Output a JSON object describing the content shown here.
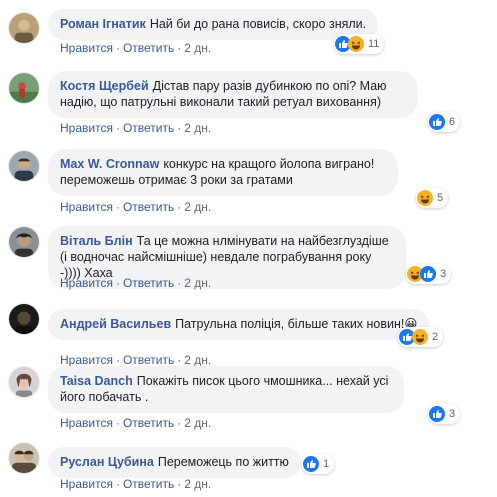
{
  "ui": {
    "like_label": "Нравится",
    "reply_label": "Ответить",
    "separator": "·"
  },
  "comments": [
    {
      "author": "Роман Ігнатик",
      "text": "Най би до рана повисів, скоро зняли.",
      "time": "2 дн.",
      "reactions": [
        "like",
        "haha"
      ],
      "reaction_count": "11"
    },
    {
      "author": "Костя Щербей",
      "text": "Дістав пару разів дубинкою по опі? Маю надію, що патрульні виконали такий ретуал виховання)",
      "time": "2 дн.",
      "reactions": [
        "like"
      ],
      "reaction_count": "6"
    },
    {
      "author": "Max W. Cronnaw",
      "text": "конкурс на кращого йолопа виграно! переможешь отримає 3 роки за гратами",
      "time": "2 дн.",
      "reactions": [
        "haha"
      ],
      "reaction_count": "5"
    },
    {
      "author": "Віталь Блін",
      "text": "Та це можна нлмінувати на найбезглуздіше (і водночас найсмішніше) невдале пограбування року -)))) Хаха",
      "time": "2 дн.",
      "reactions": [
        "haha",
        "like"
      ],
      "reaction_count": "3"
    },
    {
      "author": "Андрей Васильев",
      "text": "Патрульна поліція, більше таких новин!",
      "emoji": "😀",
      "time": "2 дн.",
      "reactions": [
        "like",
        "haha"
      ],
      "reaction_count": "2"
    },
    {
      "author": "Taisa Danch",
      "text": "Покажіть писок цього чмошника... нехай усі його побачать .",
      "time": "2 дн.",
      "reactions": [
        "like"
      ],
      "reaction_count": "3"
    },
    {
      "author": "Руслан Цубина",
      "text": "Переможець по життю",
      "time": "2 дн.",
      "reactions": [
        "like"
      ],
      "reaction_count": "1"
    }
  ],
  "colors": {
    "link": "#385898",
    "bubble": "#f2f3f5",
    "like": "#1877f2",
    "haha": "#f7b125"
  }
}
